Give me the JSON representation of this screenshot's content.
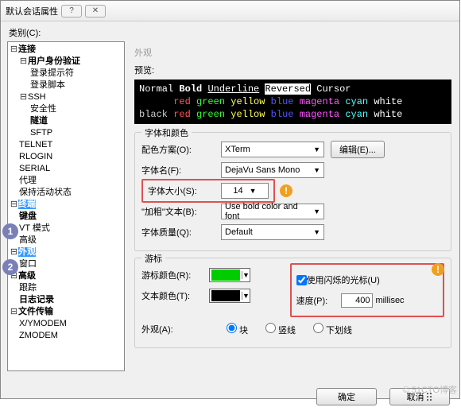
{
  "title": "默认会话属性",
  "category_label": "类别(C):",
  "tree": {
    "connection": {
      "label": "连接",
      "children": {
        "auth": {
          "label": "用户身份验证",
          "children": {
            "prompt": "登录提示符",
            "script": "登录脚本"
          }
        },
        "ssh": {
          "label": "SSH",
          "children": {
            "security": "安全性",
            "tunnel": "隧道",
            "sftp": "SFTP"
          }
        },
        "telnet": "TELNET",
        "rlogin": "RLOGIN",
        "serial": "SERIAL",
        "proxy": "代理",
        "keepalive": "保持活动状态"
      }
    },
    "terminal": {
      "label": "终端",
      "children": {
        "keyboard": "键盘",
        "vt": "VT 模式",
        "adv": "高级"
      }
    },
    "appearance": {
      "label": "外观",
      "children": {
        "window": "窗口"
      }
    },
    "advanced": {
      "label": "高级",
      "children": {
        "trace": "跟踪",
        "log": "日志记录"
      }
    },
    "transfer": {
      "label": "文件传输",
      "children": {
        "xy": "X/YMODEM",
        "z": "ZMODEM"
      }
    }
  },
  "panel_title": "外观",
  "preview_label": "预览:",
  "terminal_sample": {
    "normal": "Normal",
    "bold": "Bold",
    "underline": "Underline",
    "reversed": "Reversed",
    "cursor": "Cursor",
    "black": "black",
    "red": "red",
    "green": "green",
    "yellow": "yellow",
    "blue": "blue",
    "magenta": "magenta",
    "cyan": "cyan",
    "white": "white"
  },
  "fontcolor": {
    "group": "字体和颜色",
    "scheme_label": "配色方案(O):",
    "scheme_value": "XTerm",
    "edit_btn": "编辑(E)...",
    "fontname_label": "字体名(F):",
    "fontname_value": "DejaVu Sans Mono",
    "fontsize_label": "字体大小(S):",
    "fontsize_value": "14",
    "bold_label": "\"加粗\"文本(B):",
    "bold_value": "Use bold color and font",
    "quality_label": "字体质量(Q):",
    "quality_value": "Default"
  },
  "cursor": {
    "group": "游标",
    "cursor_color_label": "游标颜色(R):",
    "cursor_color": "#00cc00",
    "text_color_label": "文本颜色(T):",
    "text_color": "#000000",
    "blink_label": "使用闪烁的光标(U)",
    "speed_label": "速度(P):",
    "speed_value": "400",
    "speed_unit": "millisec",
    "appearance_label": "外观(A):",
    "opt_block": "块",
    "opt_vert": "竖线",
    "opt_under": "下划线"
  },
  "footer": {
    "ok": "确定",
    "cancel": "取消"
  },
  "watermark": "© 51CTO博客"
}
